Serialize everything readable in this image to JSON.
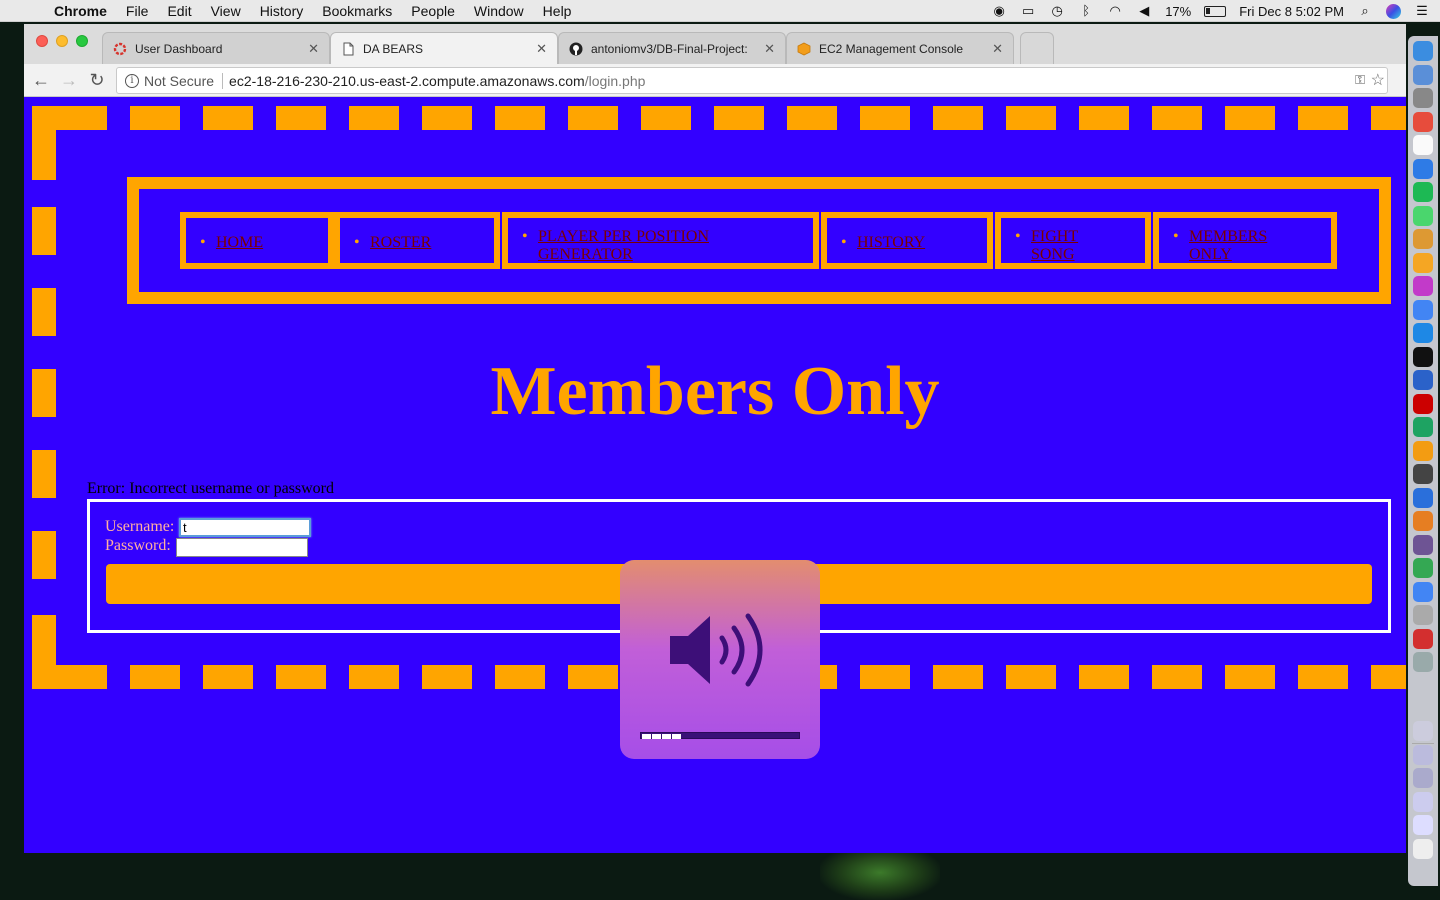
{
  "menubar": {
    "app_name": "Chrome",
    "items": [
      "File",
      "Edit",
      "View",
      "History",
      "Bookmarks",
      "People",
      "Window",
      "Help"
    ],
    "battery_percent": "17%",
    "clock": "Fri Dec 8  5:02 PM",
    "status_icons": [
      "chrome-sync-icon",
      "airplay-icon",
      "time-machine-icon",
      "bluetooth-icon",
      "wifi-icon",
      "volume-icon",
      "battery-icon",
      "spotlight-icon",
      "siri-icon",
      "notification-center-icon"
    ]
  },
  "browser": {
    "tabs": [
      {
        "title": "User Dashboard",
        "favicon": "red-ring-icon",
        "active": false
      },
      {
        "title": "DA BEARS",
        "favicon": "document-icon",
        "active": true
      },
      {
        "title": "antoniomv3/DB-Final-Project:",
        "favicon": "github-icon",
        "active": false
      },
      {
        "title": "EC2 Management Console",
        "favicon": "aws-cube-icon",
        "active": false
      }
    ],
    "security_label": "Not Secure",
    "url_host": "ec2-18-216-230-210.us-east-2.compute.amazonaws.com",
    "url_path": "/login.php"
  },
  "page": {
    "nav": [
      {
        "label": "HOME"
      },
      {
        "label": "ROSTER"
      },
      {
        "label": "PLAYER PER POSITION GENERATOR"
      },
      {
        "label": "HISTORY"
      },
      {
        "label": "FIGHT SONG"
      },
      {
        "label": "MEMBERS ONLY"
      }
    ],
    "title": "Members Only",
    "error": "Error: Incorrect username or password",
    "username_label": "Username:",
    "password_label": "Password:",
    "username_value": "t",
    "password_value": ""
  },
  "volume_hud": {
    "level": 0.25,
    "segments_total": 16,
    "segments_filled": 4
  },
  "colors": {
    "page_background": "#3300ff",
    "accent": "#ffa500",
    "link": "#7a0000",
    "form_label": "#ffb0a0"
  }
}
